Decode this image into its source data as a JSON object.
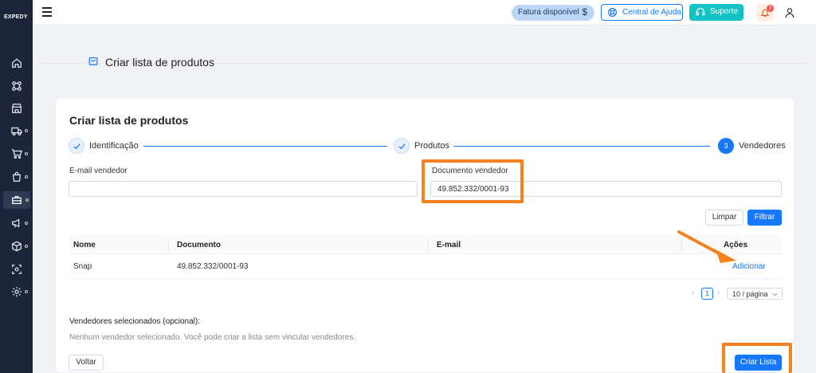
{
  "sidebar": {
    "logo": "EXPEDY",
    "icons": [
      "home-icon",
      "network-icon",
      "store-icon",
      "truck-icon",
      "cart-icon",
      "bag-icon",
      "briefcase-icon",
      "megaphone-icon",
      "box-icon",
      "scan-icon",
      "gear-icon"
    ]
  },
  "header": {
    "fatura_label": "Fatura disponível",
    "fatura_symbol": "$",
    "ajuda_label": "Central de Ajuda",
    "suporte_label": "Suporte",
    "notification_count": "3"
  },
  "page": {
    "title": "Criar lista de produtos"
  },
  "card": {
    "title": "Criar lista de produtos",
    "steps": [
      {
        "label": "Identificação",
        "state": "done"
      },
      {
        "label": "Produtos",
        "state": "done"
      },
      {
        "number": "3",
        "label": "Vendedores",
        "state": "current"
      }
    ],
    "filters": {
      "email_label": "E-mail vendedor",
      "email_value": "",
      "document_label": "Documento vendedor",
      "document_value": "49.852.332/0001-93"
    },
    "buttons": {
      "clear": "Limpar",
      "filter": "Filtrar"
    },
    "table": {
      "columns": [
        "Nome",
        "Documento",
        "E-mail",
        "Ações"
      ],
      "rows": [
        {
          "nome": "Snap",
          "documento": "49.852.332/0001-93",
          "email": "",
          "acao": "Adicionar"
        }
      ]
    },
    "pagination": {
      "prev": "‹",
      "current": "1",
      "next": "›",
      "page_size": "10 / página"
    },
    "selected": {
      "label": "Vendedores selecionados (opcional):",
      "empty": "Nenhum vendedor selecionado. Você pode criar a lista sem vincular vendedores."
    },
    "footer": {
      "back": "Voltar",
      "create": "Criar Lista"
    }
  },
  "colors": {
    "primary": "#1677ff",
    "sidebar": "#1c2539",
    "highlight": "#f5821f",
    "suporte": "#13c2c2"
  }
}
